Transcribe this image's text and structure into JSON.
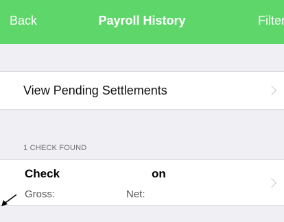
{
  "navbar": {
    "back_label": "Back",
    "title": "Payroll History",
    "filter_label": "Filter",
    "background": "#5ed66a"
  },
  "pending": {
    "label": "View Pending Settlements"
  },
  "section": {
    "header": "1 CHECK FOUND"
  },
  "check": {
    "title": "Check",
    "on_label": "on",
    "gross_label": "Gross:",
    "net_label": "Net:"
  },
  "icons": [
    "chevron-right-icon",
    "annotation-arrow-icon"
  ]
}
